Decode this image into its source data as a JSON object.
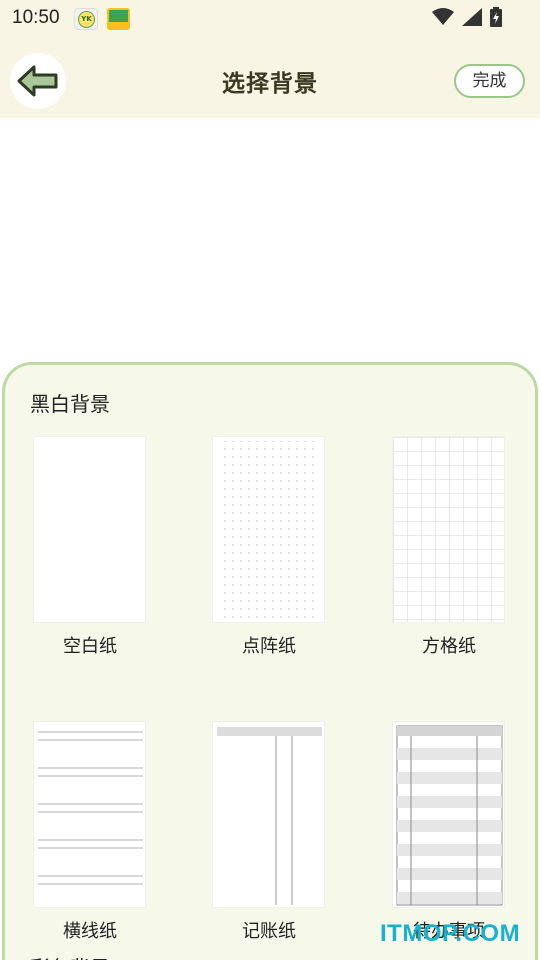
{
  "status_bar": {
    "time": "10:50",
    "app_icon_1_text": "YK",
    "icons": [
      "wifi-icon",
      "signal-icon",
      "battery-icon"
    ]
  },
  "header": {
    "back_icon": "arrow-left-icon",
    "title": "选择背景",
    "done_label": "完成"
  },
  "sections": [
    {
      "title": "黑白背景",
      "items": [
        {
          "label": "空白纸",
          "pattern": "blank"
        },
        {
          "label": "点阵纸",
          "pattern": "dots"
        },
        {
          "label": "方格纸",
          "pattern": "grid"
        },
        {
          "label": "横线纸",
          "pattern": "lines"
        },
        {
          "label": "记账纸",
          "pattern": "ledger"
        },
        {
          "label": "待办事项",
          "pattern": "todo"
        }
      ]
    },
    {
      "title": "彩色背景"
    }
  ],
  "watermark": "ITMOP.COM",
  "colors": {
    "header_bg": "#f8f5e4",
    "panel_bg": "#f6f9e9",
    "panel_border": "#bcd9a6",
    "accent_green": "#9bc58b",
    "watermark": "#18b2cf"
  }
}
